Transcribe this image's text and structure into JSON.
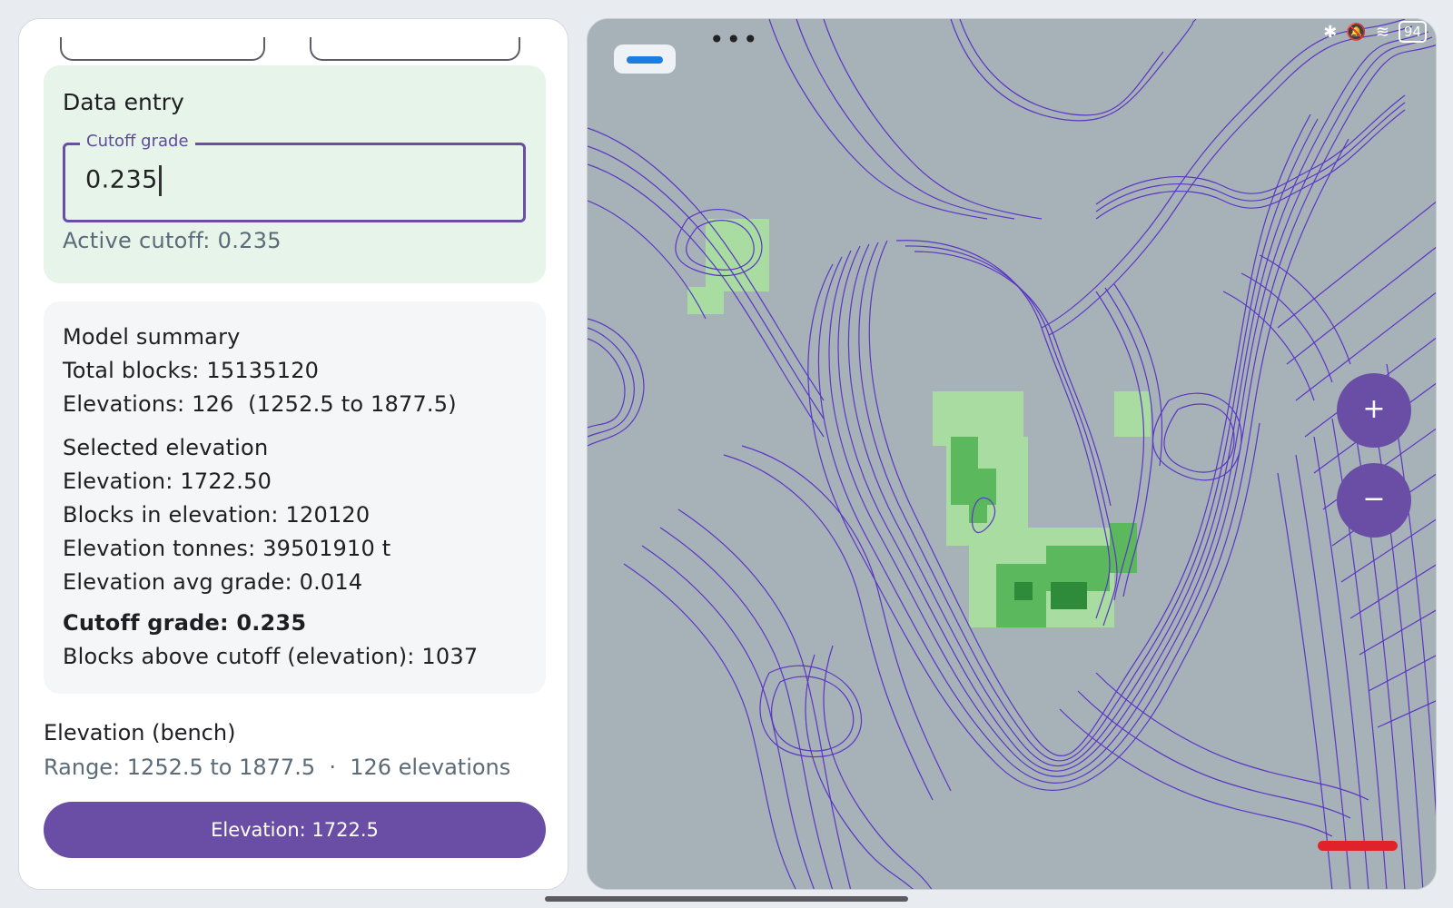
{
  "data_entry": {
    "title": "Data entry",
    "field_label": "Cutoff grade",
    "field_value": "0.235",
    "active_cutoff": "Active cutoff: 0.235"
  },
  "summary": {
    "title": "Model summary",
    "total_blocks": "Total blocks: 15135120",
    "elevations": "Elevations: 126  (1252.5 to 1877.5)",
    "selected_title": "Selected elevation",
    "elevation": "Elevation: 1722.50",
    "blocks_in_elevation": "Blocks in elevation: 120120",
    "elevation_tonnes": "Elevation tonnes: 39501910 t",
    "elevation_avg_grade": "Elevation avg grade: 0.014",
    "cutoff_title": "Cutoff grade: 0.235",
    "blocks_above": "Blocks above cutoff (elevation): 1037"
  },
  "elevation_section": {
    "title": "Elevation (bench)",
    "range": "Range: 1252.5 to 1877.5  ·  126 elevations",
    "button_label": "Elevation: 1722.5"
  },
  "map": {
    "status_dots": "•••",
    "battery": "94",
    "zoom_in": "+",
    "zoom_out": "−",
    "contour_color": "#5b35c4",
    "background_color": "#a7b2b8",
    "grade_colors": [
      "#a8dca0",
      "#5cb85c",
      "#2e8b3a"
    ]
  },
  "colors": {
    "accent": "#6a4ea5",
    "entry_card": "#e6f4e9",
    "scale_bar": "#e0232a"
  }
}
